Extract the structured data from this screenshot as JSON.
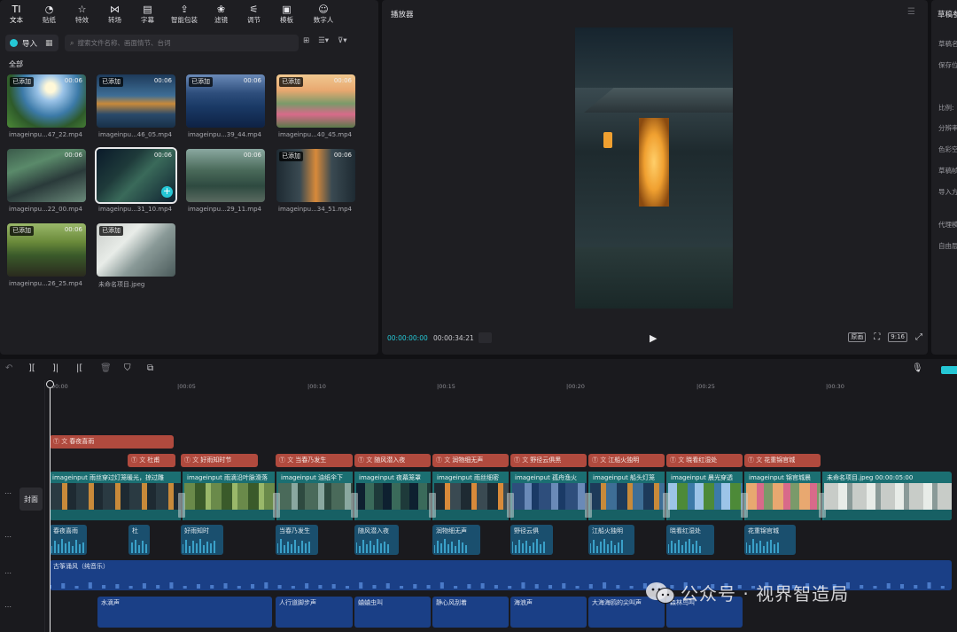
{
  "toolbar": {
    "items": [
      {
        "label": "文本",
        "icon": "TI"
      },
      {
        "label": "贴纸",
        "icon": "◔"
      },
      {
        "label": "特效",
        "icon": "☆"
      },
      {
        "label": "转场",
        "icon": "⋈"
      },
      {
        "label": "字幕",
        "icon": "▤"
      },
      {
        "label": "智能包装",
        "icon": "⇪"
      },
      {
        "label": "滤镜",
        "icon": "❀"
      },
      {
        "label": "调节",
        "icon": "⚟"
      },
      {
        "label": "模板",
        "icon": "▣"
      },
      {
        "label": "数字人",
        "icon": "☺"
      }
    ]
  },
  "media": {
    "import_label": "导入",
    "search_placeholder": "搜索文件名称、画面情节、台词",
    "section_label": "全部",
    "clips": [
      {
        "name": "imageinpu...47_22.mp4",
        "badge": "已添加",
        "duration": "00:06"
      },
      {
        "name": "imageinpu...46_05.mp4",
        "badge": "已添加",
        "duration": "00:06"
      },
      {
        "name": "imageinpu...39_44.mp4",
        "badge": "已添加",
        "duration": "00:06"
      },
      {
        "name": "imageinpu...40_45.mp4",
        "badge": "已添加",
        "duration": "00:06"
      },
      {
        "name": "imageinpu...22_00.mp4",
        "badge": "",
        "duration": "00:06"
      },
      {
        "name": "imageinpu...31_10.mp4",
        "badge": "",
        "duration": "00:06"
      },
      {
        "name": "imageinpu...29_11.mp4",
        "badge": "",
        "duration": "00:06"
      },
      {
        "name": "imageinpu...34_51.mp4",
        "badge": "已添加",
        "duration": "00:06"
      },
      {
        "name": "imageinpu...26_25.mp4",
        "badge": "已添加",
        "duration": "00:06"
      },
      {
        "name": "未命名项目.jpeg",
        "badge": "已添加",
        "duration": ""
      }
    ]
  },
  "player": {
    "title": "播放器",
    "current_time": "00:00:00:00",
    "total_time": "00:00:34:21",
    "original_label": "原画",
    "ratio_label": "9:16"
  },
  "draft": {
    "title": "草稿参",
    "items": [
      "草稿名",
      "保存位",
      "比例:",
      "分辨率",
      "色彩空",
      "草稿帧",
      "导入方",
      "代理模",
      "自由层"
    ]
  },
  "timeline": {
    "cover_label": "封面",
    "ruler": [
      "00:00",
      "|00:05",
      "|00:10",
      "|00:15",
      "|00:20",
      "|00:25",
      "|00:30"
    ],
    "text_clips": [
      {
        "label": "春夜喜雨"
      },
      {
        "label": "杜甫"
      },
      {
        "label": "好雨知时节"
      },
      {
        "label": "当春乃发生"
      },
      {
        "label": "随风潜入夜"
      },
      {
        "label": "润物细无声"
      },
      {
        "label": "野径云俱黑"
      },
      {
        "label": "江船火独明"
      },
      {
        "label": "晓看红湿处"
      },
      {
        "label": "花重锦官城"
      }
    ],
    "video_segments": [
      {
        "label": "imageinput 雨丝穿过灯笼暖光，掠过雕"
      },
      {
        "label": "imageinput 雨滴沿叶脉滑落"
      },
      {
        "label": "imageinput 油纸伞下"
      },
      {
        "label": "imageinput 夜幕笼罩"
      },
      {
        "label": "imageinput 雨丝细密"
      },
      {
        "label": "imageinput 孤舟渔火"
      },
      {
        "label": "imageinput 船头灯笼"
      },
      {
        "label": "imageinput 晨光穿透"
      },
      {
        "label": "imageinput 锦官城晨"
      },
      {
        "label": "未命名项目.jpeg  00:00:05:00"
      }
    ],
    "voice_clips": [
      {
        "label": "春夜喜雨"
      },
      {
        "label": "杜"
      },
      {
        "label": "好雨知时"
      },
      {
        "label": "当春乃发生"
      },
      {
        "label": "随风潜入夜"
      },
      {
        "label": "润物细无声"
      },
      {
        "label": "野径云俱"
      },
      {
        "label": "江船火独明"
      },
      {
        "label": "晓看红湿处"
      },
      {
        "label": "花重锦官城"
      }
    ],
    "music_label": "古筝涌风（纯音乐）",
    "sfx_clips": [
      {
        "label": "水滴声"
      },
      {
        "label": "人行道脚步声"
      },
      {
        "label": "蛐蛐虫叫"
      },
      {
        "label": "静心风刮着"
      },
      {
        "label": "海浪声"
      },
      {
        "label": "大海海鸥的尖叫声"
      },
      {
        "label": "森林鸟叫"
      }
    ]
  },
  "watermark": {
    "text": "公众号 · 视界智造局"
  },
  "colors": {
    "accent": "#25c7d5",
    "text_clip": "#b04a3e",
    "video_track": "#1b6f72",
    "voice_track": "#1a4f6e",
    "music_track": "#1a3f86"
  }
}
